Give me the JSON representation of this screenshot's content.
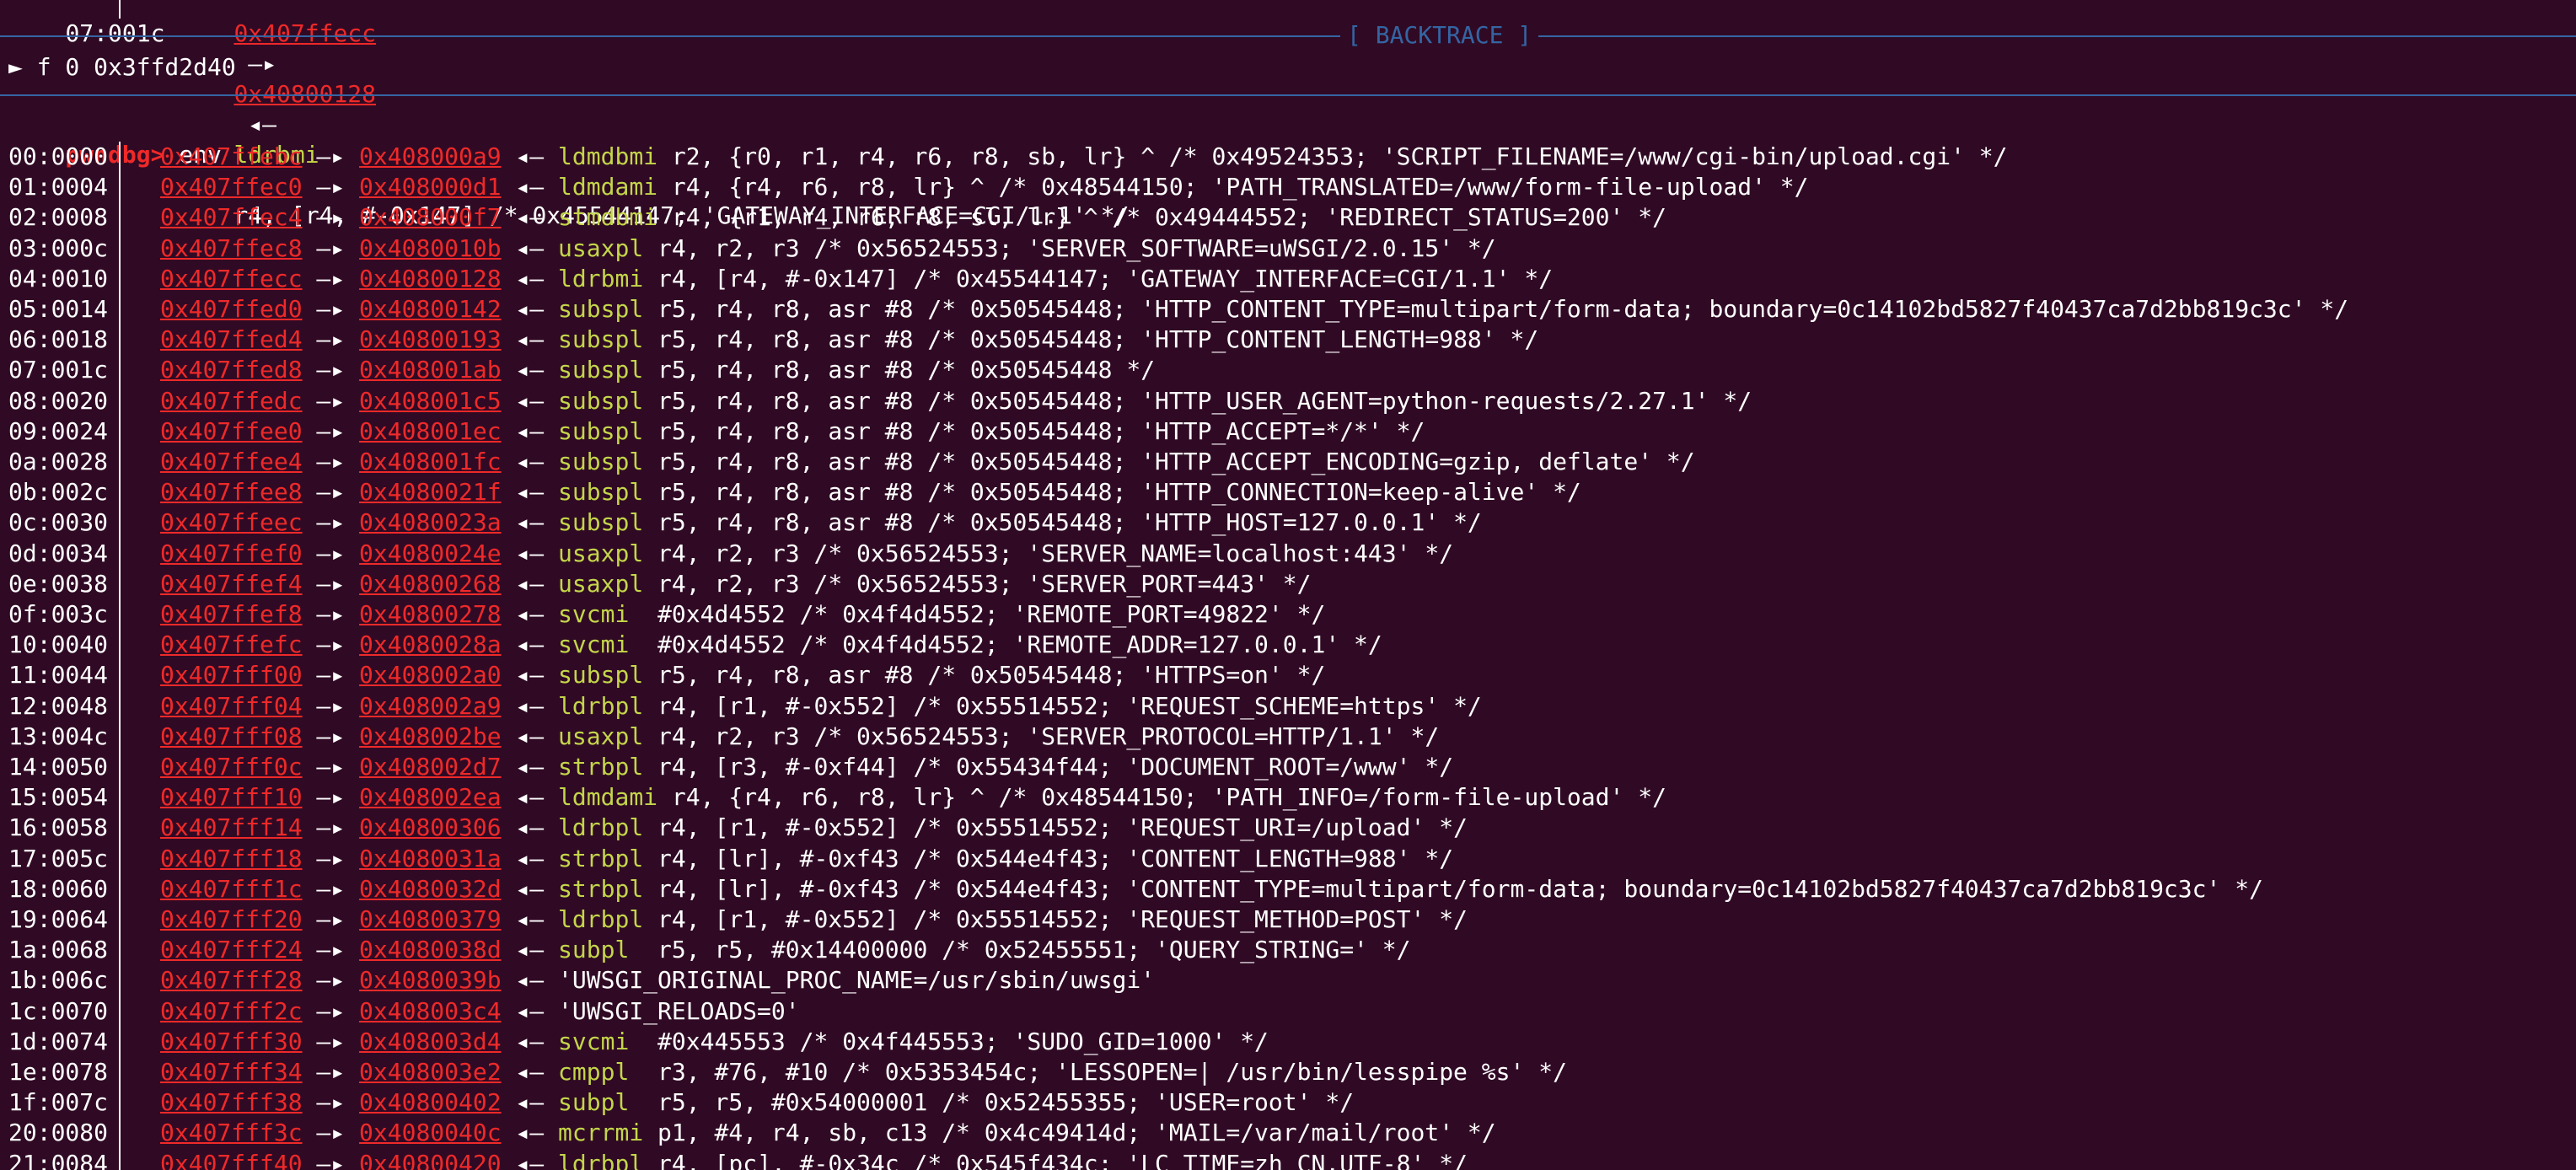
{
  "top_partial": {
    "offset": "07:001c",
    "addr1": "0x407ffecc",
    "addr2": "0x40800128",
    "mnemonic": "ldrbmi",
    "operands": "r4, [r4, #-0x147] /* 0x45544147; 'GATEWAY_INTERFACE=CGI/1.1' */"
  },
  "backtrace": {
    "title": "[ BACKTRACE ]",
    "frame": "► f 0 0x3ffd2d40"
  },
  "prompt": {
    "label": "pwndbg>",
    "command": " env"
  },
  "colors": {
    "background": "#300a24",
    "address": "#ef2929",
    "mnemonic": "#c4d64a",
    "register": "#73b6e8",
    "immediate": "#ad7fa8",
    "separator": "#3465a4"
  },
  "rows": [
    {
      "off": "00:0000",
      "a1": "0x407ffebc",
      "a2": "0x408000a9",
      "m": "ldmdbmi",
      "rest": "r2, {r0, r1, r4, r6, r8, sb, lr} ^ /* 0x49524353; 'SCRIPT_FILENAME=/www/cgi-bin/upload.cgi' */"
    },
    {
      "off": "01:0004",
      "a1": "0x407ffec0",
      "a2": "0x408000d1",
      "m": "ldmdami",
      "rest": "r4, {r4, r6, r8, lr} ^ /* 0x48544150; 'PATH_TRANSLATED=/www/form-file-upload' */"
    },
    {
      "off": "02:0008",
      "a1": "0x407ffec4",
      "a2": "0x408000f7",
      "m": "stmdbmi",
      "rest": "r4, {r1, r4, r6, r8, sl, lr} ^ /* 0x49444552; 'REDIRECT_STATUS=200' */"
    },
    {
      "off": "03:000c",
      "a1": "0x407ffec8",
      "a2": "0x4080010b",
      "m": "usaxpl",
      "rest": "r4, r2, r3 /* 0x56524553; 'SERVER_SOFTWARE=uWSGI/2.0.15' */"
    },
    {
      "off": "04:0010",
      "a1": "0x407ffecc",
      "a2": "0x40800128",
      "m": "ldrbmi",
      "rest": "r4, [r4, #-0x147] /* 0x45544147; 'GATEWAY_INTERFACE=CGI/1.1' */"
    },
    {
      "off": "05:0014",
      "a1": "0x407ffed0",
      "a2": "0x40800142",
      "m": "subspl",
      "rest": "r5, r4, r8, asr #8 /* 0x50545448; 'HTTP_CONTENT_TYPE=multipart/form-data; boundary=0c14102bd5827f40437ca7d2bb819c3c' */"
    },
    {
      "off": "06:0018",
      "a1": "0x407ffed4",
      "a2": "0x40800193",
      "m": "subspl",
      "rest": "r5, r4, r8, asr #8 /* 0x50545448; 'HTTP_CONTENT_LENGTH=988' */"
    },
    {
      "off": "07:001c",
      "a1": "0x407ffed8",
      "a2": "0x408001ab",
      "m": "subspl",
      "rest": "r5, r4, r8, asr #8 /* 0x50545448 */"
    },
    {
      "off": "08:0020",
      "a1": "0x407ffedc",
      "a2": "0x408001c5",
      "m": "subspl",
      "rest": "r5, r4, r8, asr #8 /* 0x50545448; 'HTTP_USER_AGENT=python-requests/2.27.1' */"
    },
    {
      "off": "09:0024",
      "a1": "0x407ffee0",
      "a2": "0x408001ec",
      "m": "subspl",
      "rest": "r5, r4, r8, asr #8 /* 0x50545448; 'HTTP_ACCEPT=*/*' */"
    },
    {
      "off": "0a:0028",
      "a1": "0x407ffee4",
      "a2": "0x408001fc",
      "m": "subspl",
      "rest": "r5, r4, r8, asr #8 /* 0x50545448; 'HTTP_ACCEPT_ENCODING=gzip, deflate' */"
    },
    {
      "off": "0b:002c",
      "a1": "0x407ffee8",
      "a2": "0x4080021f",
      "m": "subspl",
      "rest": "r5, r4, r8, asr #8 /* 0x50545448; 'HTTP_CONNECTION=keep-alive' */"
    },
    {
      "off": "0c:0030",
      "a1": "0x407ffeec",
      "a2": "0x4080023a",
      "m": "subspl",
      "rest": "r5, r4, r8, asr #8 /* 0x50545448; 'HTTP_HOST=127.0.0.1' */"
    },
    {
      "off": "0d:0034",
      "a1": "0x407ffef0",
      "a2": "0x4080024e",
      "m": "usaxpl",
      "rest": "r4, r2, r3 /* 0x56524553; 'SERVER_NAME=localhost:443' */"
    },
    {
      "off": "0e:0038",
      "a1": "0x407ffef4",
      "a2": "0x40800268",
      "m": "usaxpl",
      "rest": "r4, r2, r3 /* 0x56524553; 'SERVER_PORT=443' */"
    },
    {
      "off": "0f:003c",
      "a1": "0x407ffef8",
      "a2": "0x40800278",
      "m": "svcmi",
      "rest": " #0x4d4552 /* 0x4f4d4552; 'REMOTE_PORT=49822' */"
    },
    {
      "off": "10:0040",
      "a1": "0x407ffefc",
      "a2": "0x4080028a",
      "m": "svcmi",
      "rest": " #0x4d4552 /* 0x4f4d4552; 'REMOTE_ADDR=127.0.0.1' */"
    },
    {
      "off": "11:0044",
      "a1": "0x407fff00",
      "a2": "0x408002a0",
      "m": "subspl",
      "rest": "r5, r4, r8, asr #8 /* 0x50545448; 'HTTPS=on' */"
    },
    {
      "off": "12:0048",
      "a1": "0x407fff04",
      "a2": "0x408002a9",
      "m": "ldrbpl",
      "rest": "r4, [r1, #-0x552] /* 0x55514552; 'REQUEST_SCHEME=https' */"
    },
    {
      "off": "13:004c",
      "a1": "0x407fff08",
      "a2": "0x408002be",
      "m": "usaxpl",
      "rest": "r4, r2, r3 /* 0x56524553; 'SERVER_PROTOCOL=HTTP/1.1' */"
    },
    {
      "off": "14:0050",
      "a1": "0x407fff0c",
      "a2": "0x408002d7",
      "m": "strbpl",
      "rest": "r4, [r3, #-0xf44] /* 0x55434f44; 'DOCUMENT_ROOT=/www' */"
    },
    {
      "off": "15:0054",
      "a1": "0x407fff10",
      "a2": "0x408002ea",
      "m": "ldmdami",
      "rest": "r4, {r4, r6, r8, lr} ^ /* 0x48544150; 'PATH_INFO=/form-file-upload' */"
    },
    {
      "off": "16:0058",
      "a1": "0x407fff14",
      "a2": "0x40800306",
      "m": "ldrbpl",
      "rest": "r4, [r1, #-0x552] /* 0x55514552; 'REQUEST_URI=/upload' */"
    },
    {
      "off": "17:005c",
      "a1": "0x407fff18",
      "a2": "0x4080031a",
      "m": "strbpl",
      "rest": "r4, [lr], #-0xf43 /* 0x544e4f43; 'CONTENT_LENGTH=988' */"
    },
    {
      "off": "18:0060",
      "a1": "0x407fff1c",
      "a2": "0x4080032d",
      "m": "strbpl",
      "rest": "r4, [lr], #-0xf43 /* 0x544e4f43; 'CONTENT_TYPE=multipart/form-data; boundary=0c14102bd5827f40437ca7d2bb819c3c' */"
    },
    {
      "off": "19:0064",
      "a1": "0x407fff20",
      "a2": "0x40800379",
      "m": "ldrbpl",
      "rest": "r4, [r1, #-0x552] /* 0x55514552; 'REQUEST_METHOD=POST' */"
    },
    {
      "off": "1a:0068",
      "a1": "0x407fff24",
      "a2": "0x4080038d",
      "m": "subpl",
      "rest": " r5, r5, #0x14400000 /* 0x52455551; 'QUERY_STRING=' */"
    },
    {
      "off": "1b:006c",
      "a1": "0x407fff28",
      "a2": "0x4080039b",
      "m": "",
      "rest": "'UWSGI_ORIGINAL_PROC_NAME=/usr/sbin/uwsgi'"
    },
    {
      "off": "1c:0070",
      "a1": "0x407fff2c",
      "a2": "0x408003c4",
      "m": "",
      "rest": "'UWSGI_RELOADS=0'"
    },
    {
      "off": "1d:0074",
      "a1": "0x407fff30",
      "a2": "0x408003d4",
      "m": "svcmi",
      "rest": " #0x445553 /* 0x4f445553; 'SUDO_GID=1000' */"
    },
    {
      "off": "1e:0078",
      "a1": "0x407fff34",
      "a2": "0x408003e2",
      "m": "cmppl",
      "rest": " r3, #76, #10 /* 0x5353454c; 'LESSOPEN=| /usr/bin/lesspipe %s' */"
    },
    {
      "off": "1f:007c",
      "a1": "0x407fff38",
      "a2": "0x40800402",
      "m": "subpl",
      "rest": " r5, r5, #0x54000001 /* 0x52455355; 'USER=root' */"
    },
    {
      "off": "20:0080",
      "a1": "0x407fff3c",
      "a2": "0x4080040c",
      "m": "mcrrmi",
      "rest": "p1, #4, r4, sb, c13 /* 0x4c49414d; 'MAIL=/var/mail/root' */"
    },
    {
      "off": "21:0084",
      "a1": "0x407fff40",
      "a2": "0x40800420",
      "m": "ldrbpl",
      "rest": "r4, [pc], #-0x34c /* 0x545f434c; 'LC_TIME=zh_CN.UTF-8' */"
    }
  ]
}
